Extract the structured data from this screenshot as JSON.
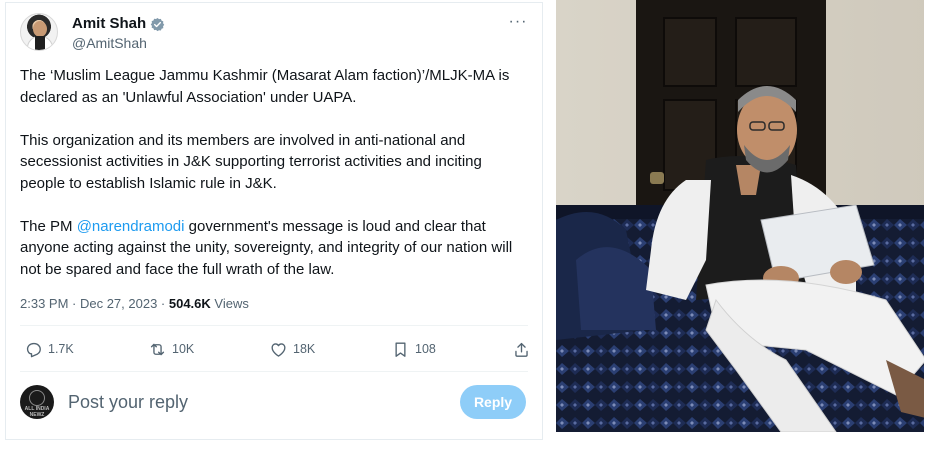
{
  "tweet": {
    "author": {
      "display_name": "Amit Shah",
      "handle": "@AmitShah",
      "verified": true
    },
    "paragraphs": [
      {
        "text": "The ‘Muslim League Jammu Kashmir (Masarat Alam faction)’/MLJK-MA is declared as an 'Unlawful Association' under UAPA."
      },
      {
        "text": "This organization and its members are involved in anti-national and secessionist activities in J&K supporting terrorist activities and inciting people to establish Islamic rule in J&K."
      },
      {
        "before": "The PM ",
        "mention": "@narendramodi",
        "after": " government's message is loud and clear that anyone acting against the unity, sovereignty, and integrity of our nation will not be spared and face the full wrath of the law."
      }
    ],
    "timestamp": "2:33 PM · Dec 27, 2023 · ",
    "views_count": "504.6K",
    "views_label": " Views",
    "actions": {
      "replies": "1.7K",
      "reposts": "10K",
      "likes": "18K",
      "bookmarks": "108"
    },
    "reply_box": {
      "placeholder": "Post your reply",
      "button_label": "Reply",
      "avatar_text": "ALL INDIA NEWZ"
    }
  },
  "colors": {
    "accent": "#1d9bf0",
    "reply_button_disabled": "#8ecdf8",
    "secondary_text": "#536471"
  }
}
